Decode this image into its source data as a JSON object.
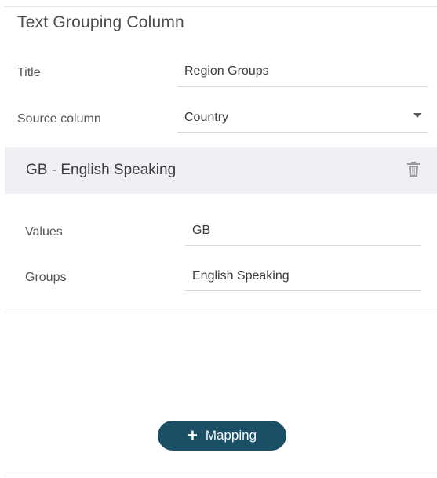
{
  "panel": {
    "title": "Text Grouping Column"
  },
  "fields": {
    "title_label": "Title",
    "title_value": "Region Groups",
    "source_label": "Source column",
    "source_value": "Country"
  },
  "group": {
    "header": "GB - English Speaking",
    "icon": "trash-icon",
    "values_label": "Values",
    "values_value": "GB",
    "groups_label": "Groups",
    "groups_value": "English Speaking"
  },
  "actions": {
    "add_mapping_label": "Mapping",
    "add_icon": "plus-icon"
  },
  "colors": {
    "button": "#1b4f66",
    "group_header_bg": "#eef0f4"
  }
}
